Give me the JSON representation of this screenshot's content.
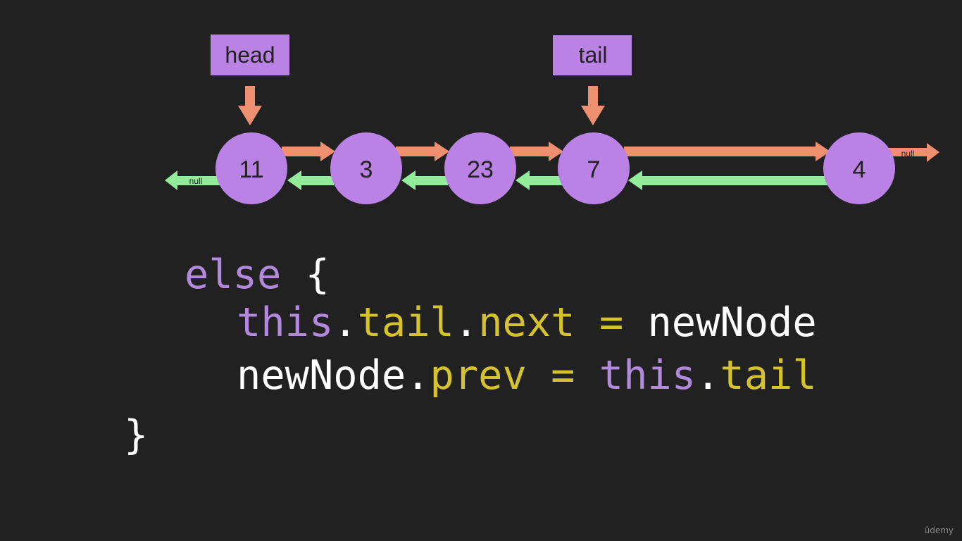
{
  "colors": {
    "background": "#222121",
    "node_fill": "#bb82e5",
    "pointer_box_fill": "#bb82e5",
    "next_arrow": "#ee9070",
    "prev_arrow": "#92ed9a",
    "keyword": "#b389dd",
    "property": "#d5c22d",
    "plain": "#ffffff"
  },
  "diagram": {
    "pointers": [
      {
        "label": "head",
        "target_index": 0
      },
      {
        "label": "tail",
        "target_index": 3
      }
    ],
    "nodes": [
      "11",
      "3",
      "23",
      "7",
      "4"
    ],
    "null_left": "null",
    "null_right": "null"
  },
  "code": {
    "line1": {
      "keyword": "else",
      "brace": " {"
    },
    "line2": {
      "this": "this",
      "dot1": ".",
      "tail": "tail",
      "dot2": ".",
      "next": "next",
      "assign": " = ",
      "value": "newNode"
    },
    "line3": {
      "target": "newNode",
      "dot1": ".",
      "prev": "prev",
      "assign": " = ",
      "this": "this",
      "dot2": ".",
      "tail": "tail"
    },
    "line4": {
      "brace": "}"
    }
  },
  "watermark": "ûdemy"
}
